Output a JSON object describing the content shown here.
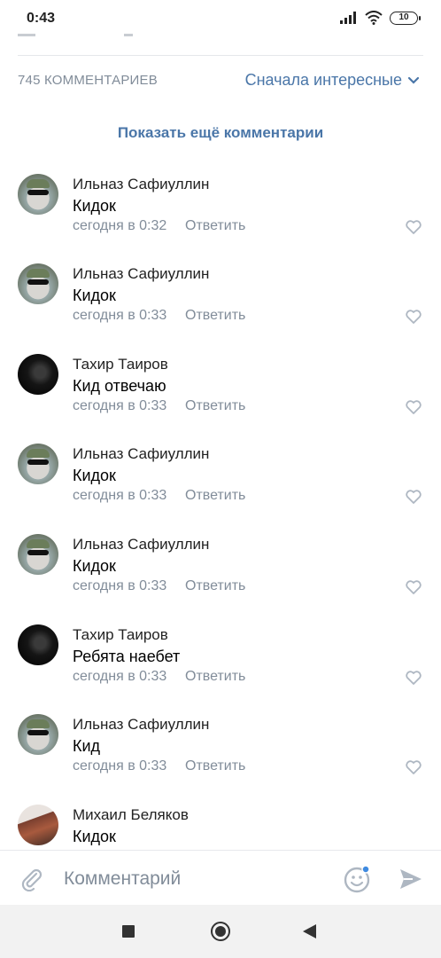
{
  "status": {
    "time": "0:43",
    "battery": "10"
  },
  "header": {
    "comment_count": "745 КОММЕНТАРИЕВ",
    "sort_label": "Сначала интересные",
    "show_more": "Показать ещё комментарии"
  },
  "comments": [
    {
      "author": "Ильназ Сафиуллин",
      "text": "Кидок",
      "time": "сегодня в 0:32",
      "reply": "Ответить",
      "avatar": "ilnaz"
    },
    {
      "author": "Ильназ Сафиуллин",
      "text": "Кидок",
      "time": "сегодня в 0:33",
      "reply": "Ответить",
      "avatar": "ilnaz"
    },
    {
      "author": "Тахир Таиров",
      "text": "Кид отвечаю",
      "time": "сегодня в 0:33",
      "reply": "Ответить",
      "avatar": "takhir"
    },
    {
      "author": "Ильназ Сафиуллин",
      "text": "Кидок",
      "time": "сегодня в 0:33",
      "reply": "Ответить",
      "avatar": "ilnaz"
    },
    {
      "author": "Ильназ Сафиуллин",
      "text": "Кидок",
      "time": "сегодня в 0:33",
      "reply": "Ответить",
      "avatar": "ilnaz"
    },
    {
      "author": "Тахир Таиров",
      "text": "Ребята наебет",
      "time": "сегодня в 0:33",
      "reply": "Ответить",
      "avatar": "takhir"
    },
    {
      "author": "Ильназ Сафиуллин",
      "text": "Кид",
      "time": "сегодня в 0:33",
      "reply": "Ответить",
      "avatar": "ilnaz"
    },
    {
      "author": "Михаил Беляков",
      "text": "Кидок",
      "avatar": "mikhail"
    }
  ],
  "input": {
    "placeholder": "Комментарий"
  },
  "colors": {
    "accent": "#4a76a8",
    "secondary_text": "#818c99",
    "icon": "#aeb7c2"
  },
  "icons": {
    "attach": "paperclip-icon",
    "emoji": "emoji-icon",
    "send": "send-icon",
    "like": "heart-icon",
    "sort": "chevron-down-icon"
  }
}
